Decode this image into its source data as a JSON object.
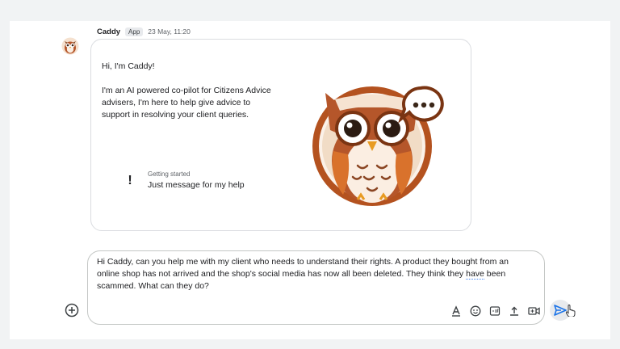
{
  "message": {
    "sender": "Caddy",
    "badge": "App",
    "timestamp": "23 May, 11:20",
    "card": {
      "title": "Hi, I'm Caddy!",
      "body": "I'm an AI powered co-pilot for Citizens Advice advisers, I'm here to help give advice to support in resolving your client queries.",
      "getting_started_label": "Getting started",
      "getting_started_text": "Just message for my help"
    }
  },
  "composer": {
    "text_before": "Hi Caddy, can you help me with my client who needs to understand their rights. A product they bought from an online shop has not arrived and the shop's social media has now all been deleted. They think they ",
    "text_flagged": "have",
    "text_after": " been scammed. What can they do?"
  },
  "icons": {
    "avatar": "owl-avatar-icon",
    "getting_started": "exclamation-icon",
    "add": "add-circle-icon",
    "format": "text-format-icon",
    "emoji": "emoji-icon",
    "gif": "gif-icon",
    "upload": "upload-icon",
    "video": "video-call-icon",
    "send": "send-icon"
  },
  "colors": {
    "owl_brown": "#a0522d",
    "owl_orange": "#d2691e",
    "send_blue": "#1a73e8"
  }
}
